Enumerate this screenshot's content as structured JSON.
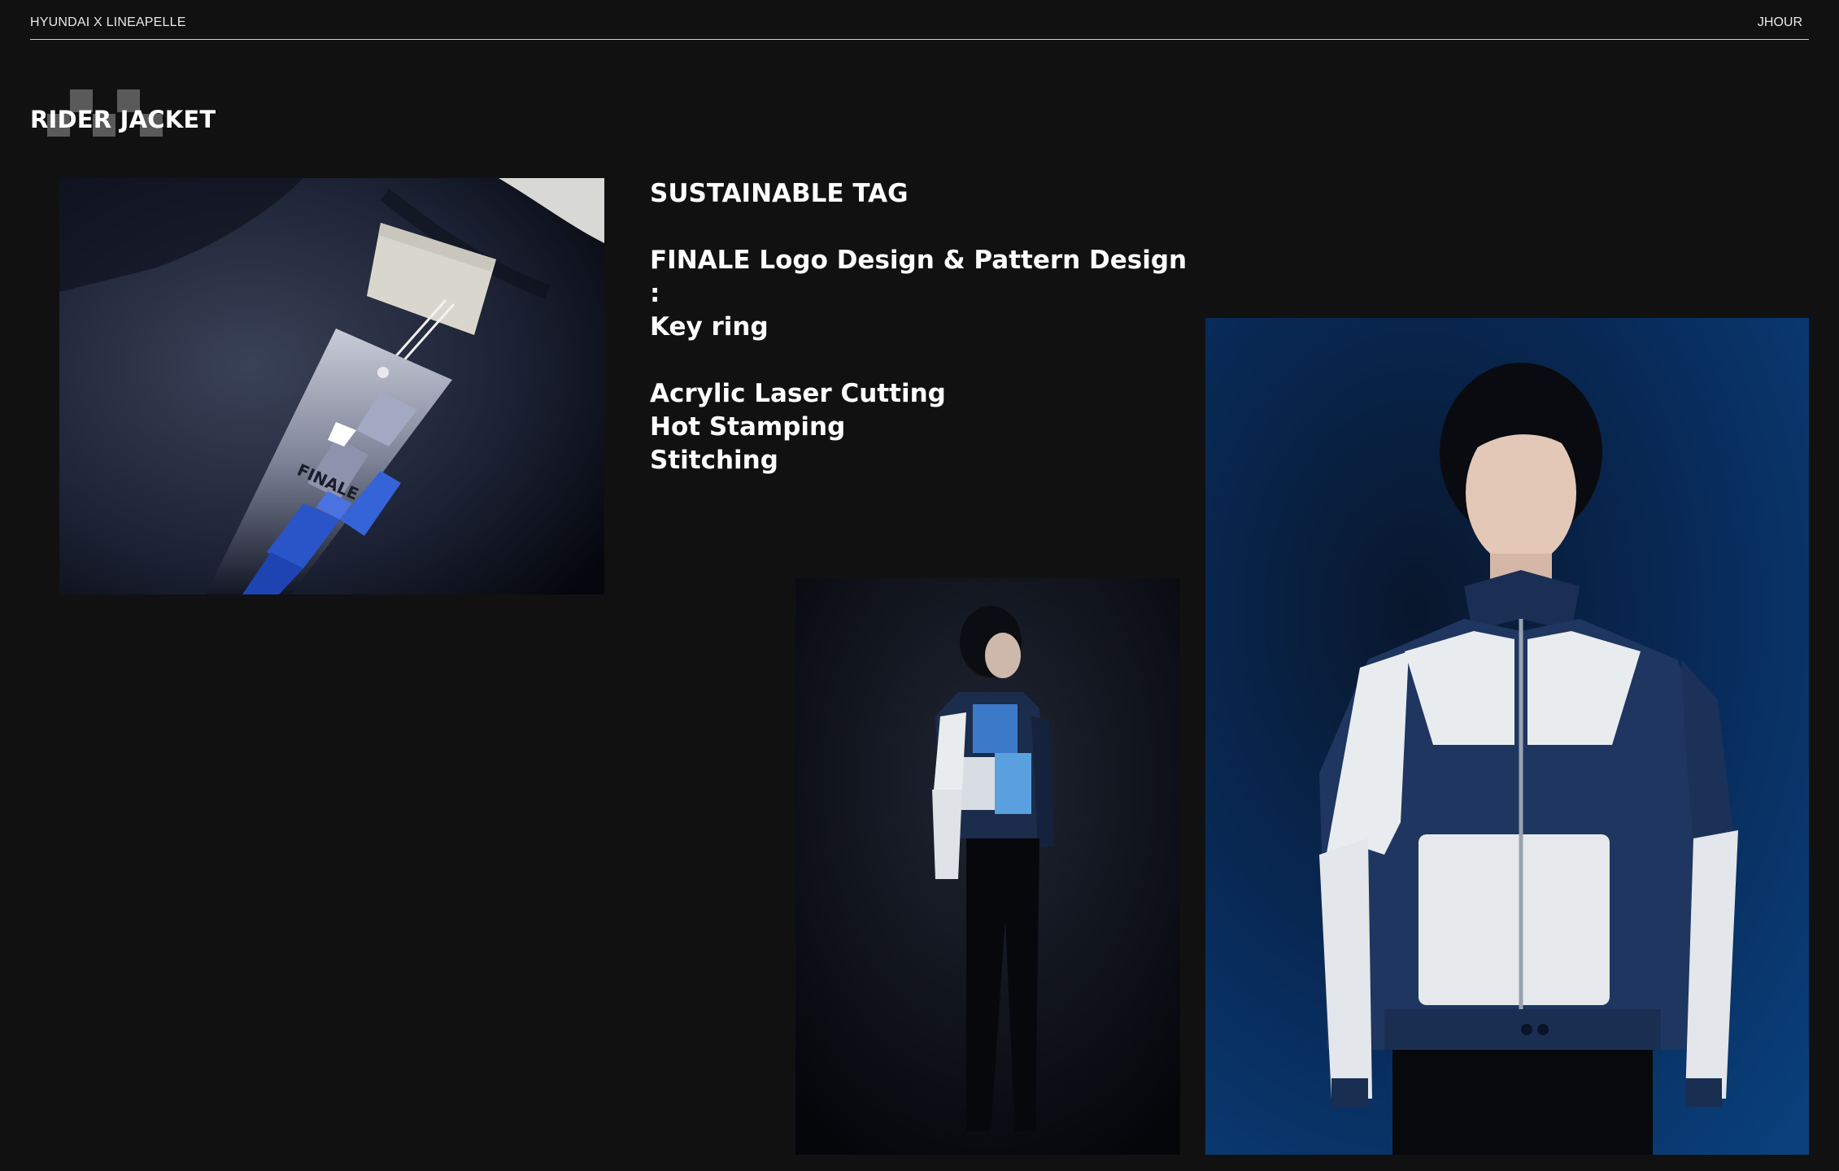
{
  "header": {
    "left_label": "HYUNDAI X LINEAPELLE",
    "right_label": "JHOUR"
  },
  "section": {
    "title": "RIDER JACKET"
  },
  "description": {
    "heading": "SUSTAINABLE TAG",
    "design_line": "FINALE Logo Design & Pattern Design",
    "separator": ":",
    "item": "Key ring",
    "techniques": [
      "Acrylic Laser Cutting",
      "Hot Stamping",
      "Stitching"
    ]
  },
  "images": {
    "tag_brand_text": "FINALE"
  },
  "colors": {
    "background": "#111111",
    "text": "#ffffff",
    "accent_blue": "#1f5fd0",
    "jacket_navy": "#1e3660",
    "jacket_white": "#e9ecef"
  }
}
